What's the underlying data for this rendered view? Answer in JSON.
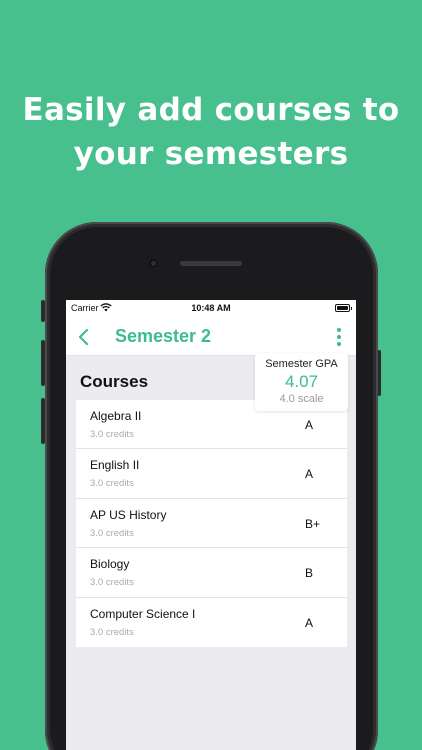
{
  "headline": {
    "line1": "Easily add courses to",
    "line2": "your semesters"
  },
  "status_bar": {
    "carrier": "Carrier",
    "time": "10:48 AM",
    "wifi_icon": "wifi-icon",
    "battery_icon": "battery-icon"
  },
  "nav": {
    "back_icon": "chevron-left-icon",
    "title": "Semester 2",
    "menu_icon": "more-vertical-icon"
  },
  "gpa": {
    "label": "Semester GPA",
    "value": "4.07",
    "scale": "4.0 scale"
  },
  "courses": {
    "title": "Courses",
    "items": [
      {
        "name": "Algebra II",
        "credits": "3.0 credits",
        "grade": "A"
      },
      {
        "name": "English II",
        "credits": "3.0 credits",
        "grade": "A"
      },
      {
        "name": "AP US History",
        "credits": "3.0 credits",
        "grade": "B+"
      },
      {
        "name": "Biology",
        "credits": "3.0 credits",
        "grade": "B"
      },
      {
        "name": "Computer Science I",
        "credits": "3.0 credits",
        "grade": "A"
      }
    ]
  },
  "colors": {
    "background": "#47c08e",
    "accent": "#3dbd8b",
    "screen_bg": "#ececf0"
  }
}
